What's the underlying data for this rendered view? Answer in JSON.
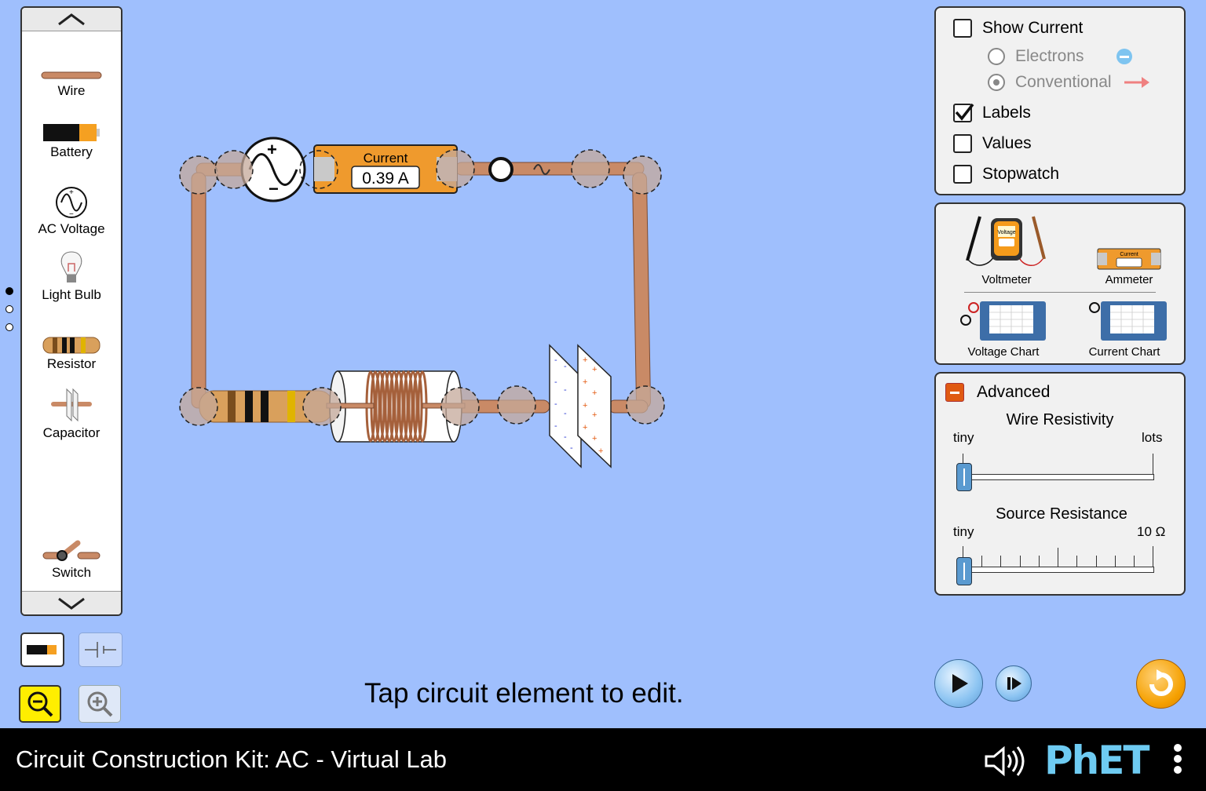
{
  "carousel": {
    "items": [
      {
        "label": "Wire",
        "icon": "wire-icon"
      },
      {
        "label": "Battery",
        "icon": "battery-icon"
      },
      {
        "label": "AC Voltage",
        "icon": "ac-voltage-icon"
      },
      {
        "label": "Light Bulb",
        "icon": "light-bulb-icon"
      },
      {
        "label": "Resistor",
        "icon": "resistor-icon"
      },
      {
        "label": "Capacitor",
        "icon": "capacitor-icon"
      },
      {
        "label": "Switch",
        "icon": "switch-icon"
      }
    ],
    "pages": 3,
    "current_page": 1
  },
  "circuit": {
    "ammeter_title": "Current",
    "ammeter_value": "0.39 A"
  },
  "status_text": "Tap circuit element to edit.",
  "display_panel": {
    "show_current": {
      "label": "Show Current",
      "checked": false
    },
    "electrons": {
      "label": "Electrons",
      "selected": false
    },
    "conventional": {
      "label": "Conventional",
      "selected": true
    },
    "labels": {
      "label": "Labels",
      "checked": true
    },
    "values": {
      "label": "Values",
      "checked": false
    },
    "stopwatch": {
      "label": "Stopwatch",
      "checked": false
    }
  },
  "tools_panel": {
    "voltmeter": "Voltmeter",
    "voltmeter_screen": "Voltage",
    "ammeter": "Ammeter",
    "ammeter_screen": "Current",
    "voltage_chart": "Voltage Chart",
    "current_chart": "Current Chart"
  },
  "advanced_panel": {
    "title": "Advanced",
    "wire_resistivity": {
      "title": "Wire Resistivity",
      "min_label": "tiny",
      "max_label": "lots",
      "value": 0
    },
    "source_resistance": {
      "title": "Source Resistance",
      "min_label": "tiny",
      "max_label": "10 Ω",
      "value": 0
    }
  },
  "navbar": {
    "title": "Circuit Construction Kit: AC - Virtual Lab",
    "logo": "PhET"
  },
  "colors": {
    "background": "#9fbffd",
    "wire": "#c98a66",
    "ammeter": "#ef9a2d",
    "reset": "#f5a000",
    "play": "#8cc4f2"
  }
}
